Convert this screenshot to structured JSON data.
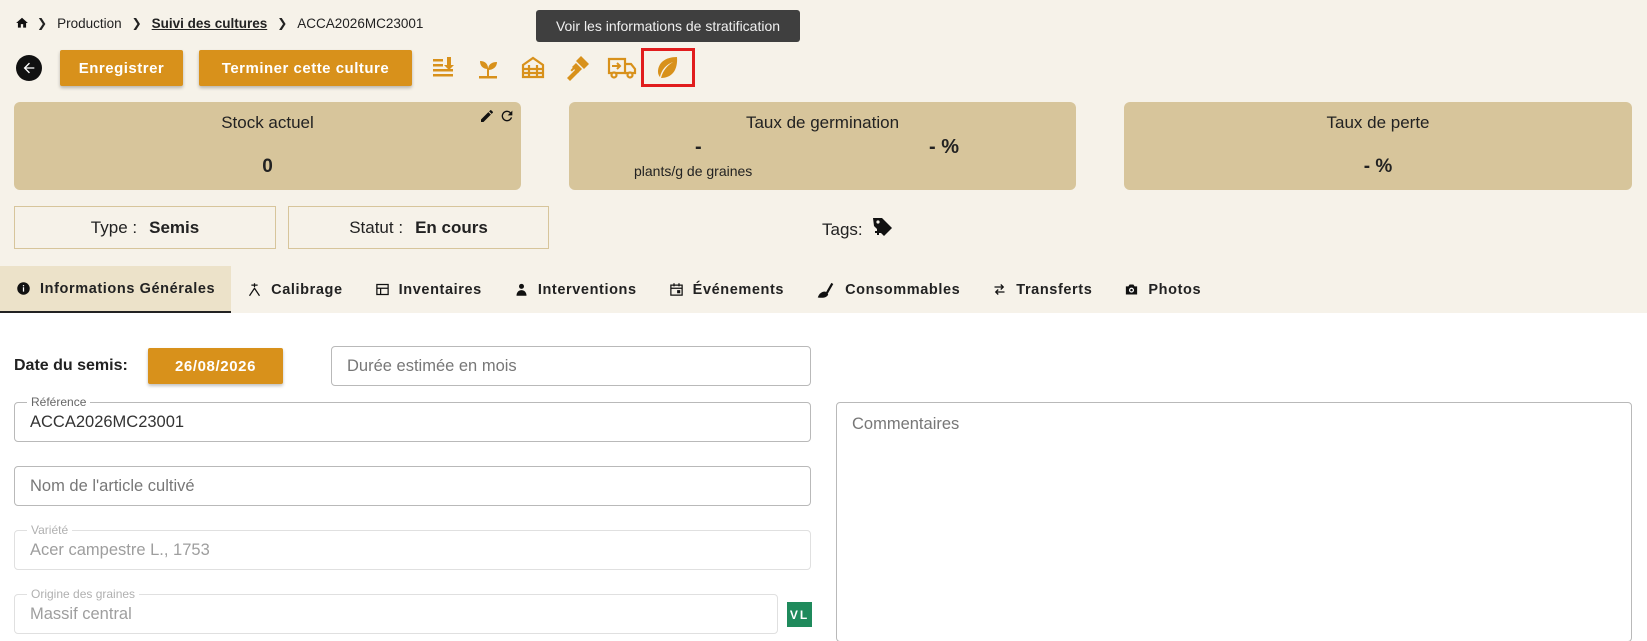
{
  "breadcrumb": {
    "items": [
      "Production",
      "Suivi des cultures",
      "ACCA2026MC23001"
    ]
  },
  "tooltip": {
    "text": "Voir les informations de stratification"
  },
  "toolbar": {
    "save_label": "Enregistrer",
    "finish_label": "Terminer cette culture",
    "icons": [
      "transfer-list-icon",
      "seedling-icon",
      "greenhouse-icon",
      "graft-icon",
      "delivery-truck-icon",
      "leaf-icon"
    ],
    "accent_color": "#d8911b"
  },
  "cards": {
    "stock": {
      "title": "Stock actuel",
      "value": "0"
    },
    "germination": {
      "title": "Taux de germination",
      "value": "-",
      "unit": "plants/g de graines",
      "percent": "- %"
    },
    "loss": {
      "title": "Taux de perte",
      "value": "- %"
    }
  },
  "info": {
    "type_label": "Type :",
    "type_value": "Semis",
    "status_label": "Statut :",
    "status_value": "En cours",
    "tags_label": "Tags:"
  },
  "tabs": [
    {
      "label": "Informations Générales",
      "icon": "info-icon",
      "active": true
    },
    {
      "label": "Calibrage",
      "icon": "calibrate-icon"
    },
    {
      "label": "Inventaires",
      "icon": "inventory-icon"
    },
    {
      "label": "Interventions",
      "icon": "worker-icon"
    },
    {
      "label": "Événements",
      "icon": "calendar-icon"
    },
    {
      "label": "Consommables",
      "icon": "shovel-icon"
    },
    {
      "label": "Transferts",
      "icon": "swap-icon"
    },
    {
      "label": "Photos",
      "icon": "camera-icon"
    }
  ],
  "form": {
    "date_label": "Date du semis:",
    "date_value": "26/08/2026",
    "duree_placeholder": "Durée estimée en mois",
    "reference_label": "Référence",
    "reference_value": "ACCA2026MC23001",
    "nom_placeholder": "Nom de l'article cultivé",
    "variete_label": "Variété",
    "variete_value": "Acer campestre L., 1753",
    "origine_label": "Origine des graines",
    "origine_value": "Massif central",
    "origine_badge": "VL",
    "commentaires_placeholder": "Commentaires"
  }
}
